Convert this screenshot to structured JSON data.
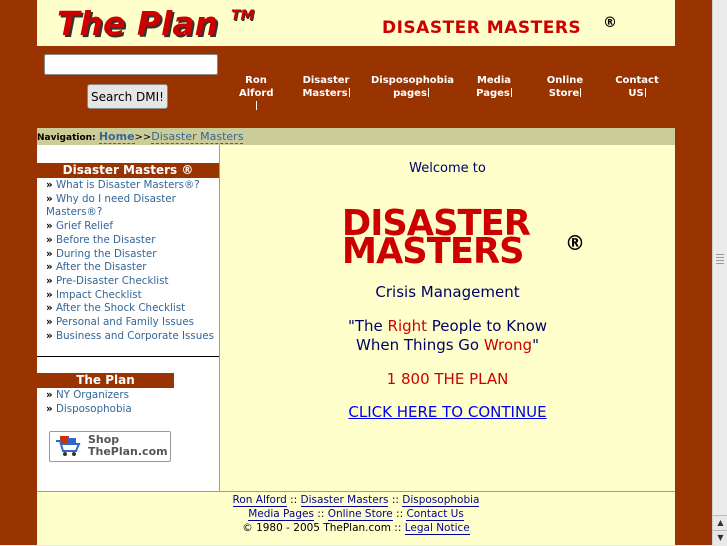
{
  "header": {
    "logo": "The Plan",
    "logo_tm": "TM",
    "title": "DISASTER MASTERS",
    "title_reg": "®"
  },
  "search": {
    "value": "",
    "button_label": "Search DMI!"
  },
  "nav": {
    "items": [
      {
        "line1": "Ron",
        "line2": "Alford"
      },
      {
        "line1": "Disaster",
        "line2": "Masters"
      },
      {
        "line1": "Disposophobia",
        "line2": "pages"
      },
      {
        "line1": "Media",
        "line2": "Pages"
      },
      {
        "line1": "Online",
        "line2": "Store"
      },
      {
        "line1": "Contact",
        "line2": "US"
      }
    ]
  },
  "breadcrumb": {
    "label": "Navigation:",
    "home": "Home",
    "separator": ">>",
    "current": "Disaster Masters"
  },
  "sidebar": {
    "dm_title": "Disaster Masters ®",
    "dm_items": [
      "What is Disaster    Masters®?",
      "Why do I need    Disaster Masters®?",
      "Grief Relief",
      "Before the Disaster",
      "During the Disaster",
      "After the Disaster",
      "Pre-Disaster Checklist",
      "Impact Checklist",
      "After the Shock    Checklist",
      "Personal and Family    Issues",
      "Business and    Corporate Issues"
    ],
    "plan_title": "The Plan",
    "plan_items": [
      "NY Organizers",
      "Disposophobia"
    ],
    "shop_line1": "Shop",
    "shop_line2": "ThePlan.com",
    "bullet": "»"
  },
  "main": {
    "welcome": "Welcome to",
    "big_line1": "DISASTER",
    "big_line2": "MASTERS",
    "big_reg": "®",
    "crisis": "Crisis Management",
    "quote_a": "\"The ",
    "quote_right": "Right",
    "quote_b": " People to Know",
    "quote_c": "When Things Go ",
    "quote_wrong": "Wrong",
    "quote_d": "\"",
    "phone": "1 800 THE PLAN",
    "continue": "CLICK HERE TO CONTINUE"
  },
  "footer": {
    "line1": [
      "Ron Alford",
      "Disaster Masters",
      "Disposophobia"
    ],
    "line2": [
      "Media Pages",
      "Online Store",
      "Contact Us"
    ],
    "copyright": "© 1980 - 2005 ThePlan.com",
    "legal": "Legal Notice",
    "sep": "::"
  },
  "colors": {
    "brand_red": "#cc0000",
    "brown": "#993300",
    "cream": "#ffffcc",
    "link_blue": "#336699"
  }
}
